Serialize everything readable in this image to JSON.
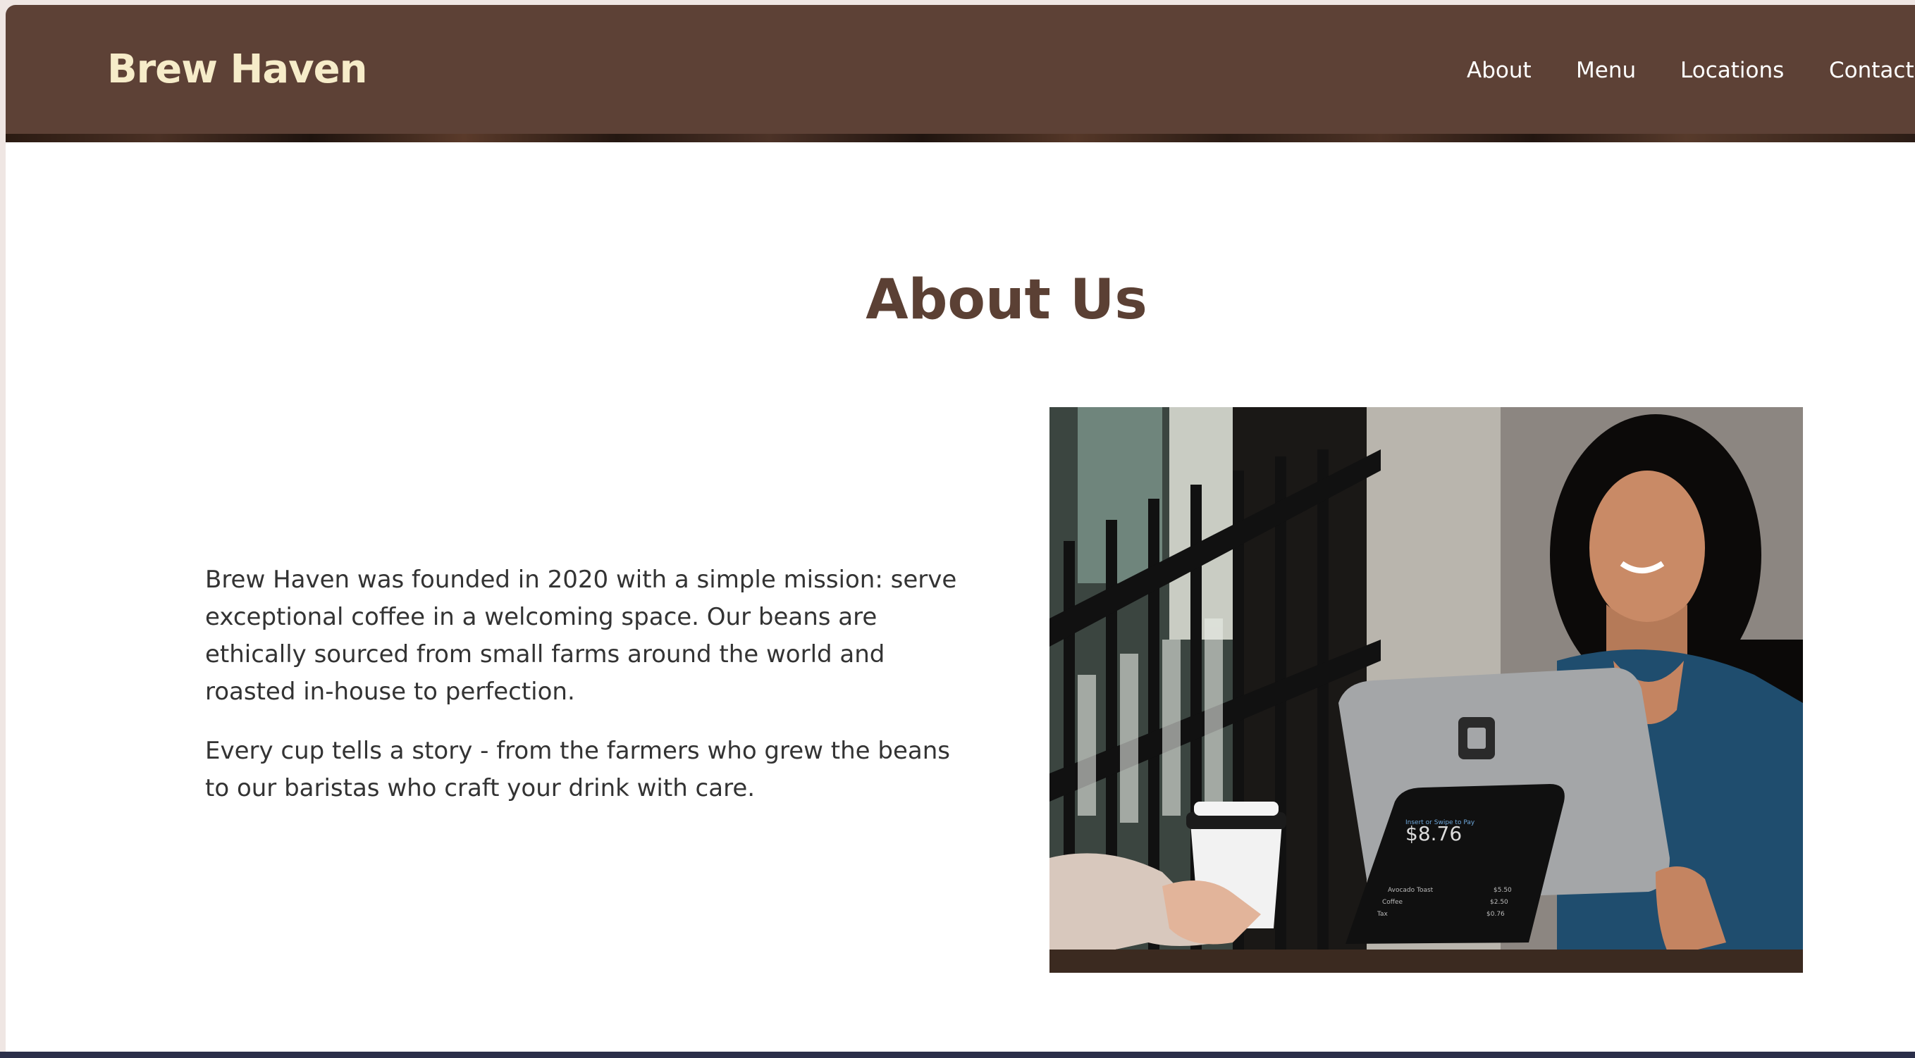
{
  "header": {
    "brand": "Brew Haven",
    "nav": [
      {
        "label": "About"
      },
      {
        "label": "Menu"
      },
      {
        "label": "Locations"
      },
      {
        "label": "Contact"
      }
    ]
  },
  "about": {
    "title": "About Us",
    "paragraphs": [
      "Brew Haven was founded in 2020 with a simple mission: serve exceptional coffee in a welcoming space. Our beans are ethically sourced from small farms around the world and roasted in-house to perfection.",
      "Every cup tells a story - from the farmers who grew the beans to our baristas who craft your drink with care."
    ],
    "photo": {
      "screen_amount": "$8.76",
      "screen_prompt": "Insert or Swipe to Pay",
      "screen_items": [
        {
          "name": "Avocado Toast",
          "price": "$5.50"
        },
        {
          "name": "Coffee",
          "price": "$2.50"
        },
        {
          "name": "Tax",
          "price": "$0.76"
        }
      ]
    }
  },
  "colors": {
    "header_bg": "#5d4136",
    "brand_text": "#f6ecc9",
    "title_text": "#5b4034",
    "body_text": "#333333"
  }
}
